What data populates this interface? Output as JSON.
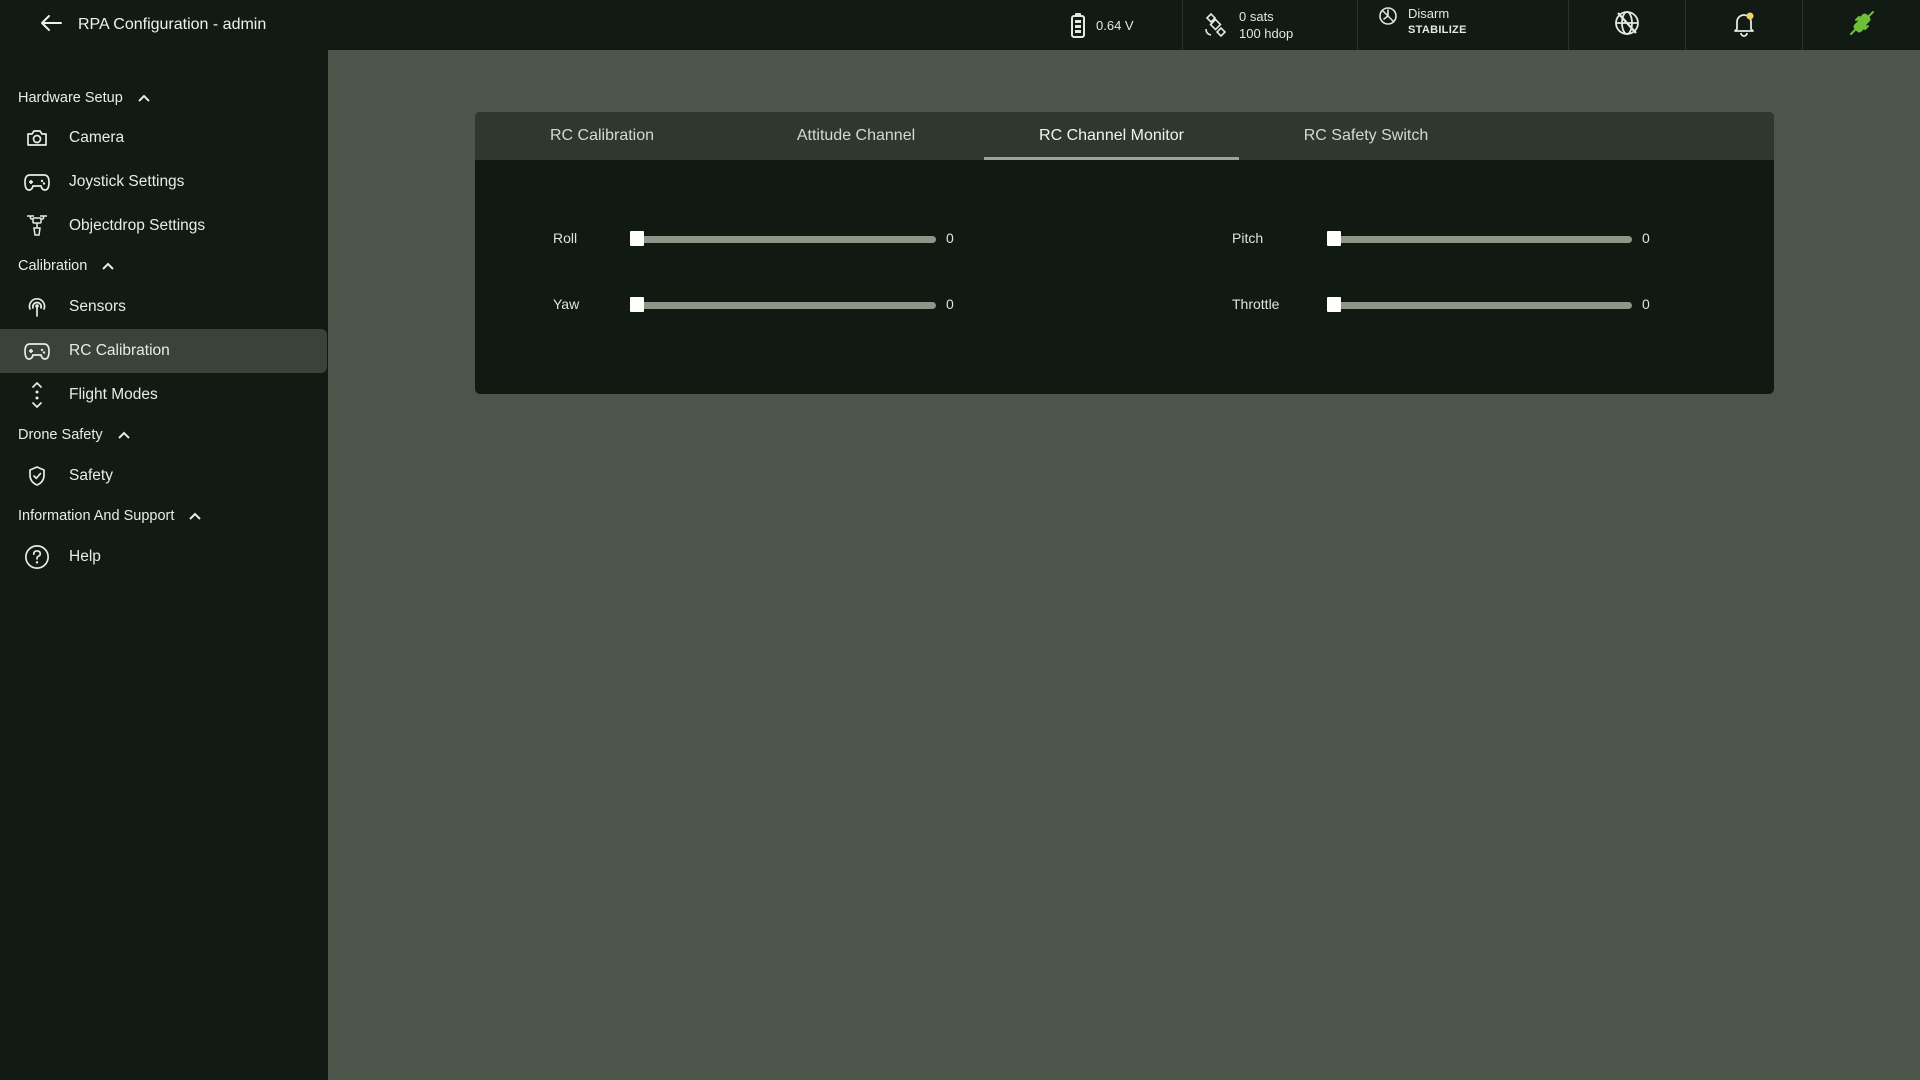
{
  "header": {
    "title": "RPA Configuration - admin",
    "back_icon": "arrow-left-icon",
    "battery": {
      "value": "0.64 V",
      "icon": "battery-icon"
    },
    "gps": {
      "sats": "0 sats",
      "hdop": "100 hdop",
      "icon": "satellite-icon"
    },
    "mode": {
      "state": "Disarm",
      "flight_mode": "STABILIZE",
      "icon": "arm-status-icon"
    },
    "icons": [
      "no-gps-globe-icon",
      "notification-bell-icon",
      "connection-plug-icon"
    ],
    "colors": {
      "background": "#121a14",
      "connected": "#6fbf3a",
      "notification_dot": "#f2d16b"
    }
  },
  "sidebar": {
    "sections": [
      {
        "label": "Hardware Setup",
        "items": [
          {
            "label": "Camera",
            "icon": "camera-icon"
          },
          {
            "label": "Joystick Settings",
            "icon": "gamepad-icon"
          },
          {
            "label": "Objectdrop Settings",
            "icon": "drone-drop-icon"
          }
        ]
      },
      {
        "label": "Calibration",
        "items": [
          {
            "label": "Sensors",
            "icon": "sensor-signal-icon"
          },
          {
            "label": "RC Calibration",
            "icon": "gamepad-icon",
            "active": true
          },
          {
            "label": "Flight Modes",
            "icon": "flight-modes-icon"
          }
        ]
      },
      {
        "label": "Drone Safety",
        "items": [
          {
            "label": "Safety",
            "icon": "shield-check-icon"
          }
        ]
      },
      {
        "label": "Information And Support",
        "items": [
          {
            "label": "Help",
            "icon": "help-circle-icon"
          }
        ]
      }
    ]
  },
  "main": {
    "tabs": [
      {
        "label": "RC Calibration"
      },
      {
        "label": "Attitude Channel"
      },
      {
        "label": "RC Channel Monitor",
        "active": true
      },
      {
        "label": "RC Safety Switch"
      }
    ],
    "channels": [
      {
        "label": "Roll",
        "value": "0",
        "level": 0
      },
      {
        "label": "Pitch",
        "value": "0",
        "level": 0
      },
      {
        "label": "Yaw",
        "value": "0",
        "level": 0
      },
      {
        "label": "Throttle",
        "value": "0",
        "level": 0
      }
    ]
  }
}
